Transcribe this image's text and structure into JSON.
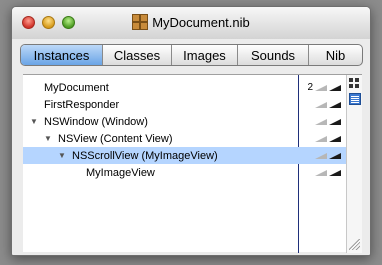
{
  "window": {
    "title": "MyDocument.nib",
    "icon": "nib-file-icon"
  },
  "tabs": [
    {
      "label": "Instances",
      "active": true
    },
    {
      "label": "Classes",
      "active": false
    },
    {
      "label": "Images",
      "active": false
    },
    {
      "label": "Sounds",
      "active": false
    },
    {
      "label": "Nib",
      "active": false
    }
  ],
  "objects": [
    {
      "label": "MyDocument",
      "indent": 0,
      "disclosure": "",
      "count": "2",
      "selected": false
    },
    {
      "label": "FirstResponder",
      "indent": 0,
      "disclosure": "",
      "count": "",
      "selected": false
    },
    {
      "label": "NSWindow (Window)",
      "indent": 0,
      "disclosure": "▼",
      "count": "",
      "selected": false
    },
    {
      "label": "NSView (Content View)",
      "indent": 1,
      "disclosure": "▼",
      "count": "",
      "selected": false
    },
    {
      "label": "NSScrollView (MyImageView)",
      "indent": 2,
      "disclosure": "▼",
      "count": "",
      "selected": true
    },
    {
      "label": "MyImageView",
      "indent": 3,
      "disclosure": "",
      "count": "",
      "selected": false
    }
  ],
  "view_buttons": [
    "grid-view-icon",
    "list-view-icon"
  ]
}
